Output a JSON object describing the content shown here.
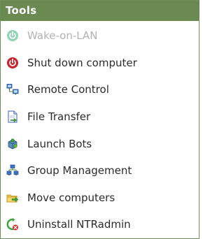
{
  "panel": {
    "title": "Tools"
  },
  "items": [
    {
      "label": "Wake-on-LAN",
      "icon": "power-icon",
      "disabled": true
    },
    {
      "label": "Shut down computer",
      "icon": "power-icon",
      "disabled": false
    },
    {
      "label": "Remote Control",
      "icon": "network-computers-icon",
      "disabled": false
    },
    {
      "label": "File Transfer",
      "icon": "file-transfer-icon",
      "disabled": false
    },
    {
      "label": "Launch Bots",
      "icon": "bots-icon",
      "disabled": false
    },
    {
      "label": "Group Management",
      "icon": "group-icon",
      "disabled": false
    },
    {
      "label": "Move computers",
      "icon": "move-folder-icon",
      "disabled": false
    },
    {
      "label": "Uninstall NTRadmin",
      "icon": "uninstall-icon",
      "disabled": false
    }
  ],
  "colors": {
    "header": "#6a8a52",
    "border": "#6f8f58",
    "text": "#2b2b2b",
    "disabled_text": "#b3b3b3",
    "power_red": "#c4262e",
    "power_disabled": "#8fd4b4"
  }
}
